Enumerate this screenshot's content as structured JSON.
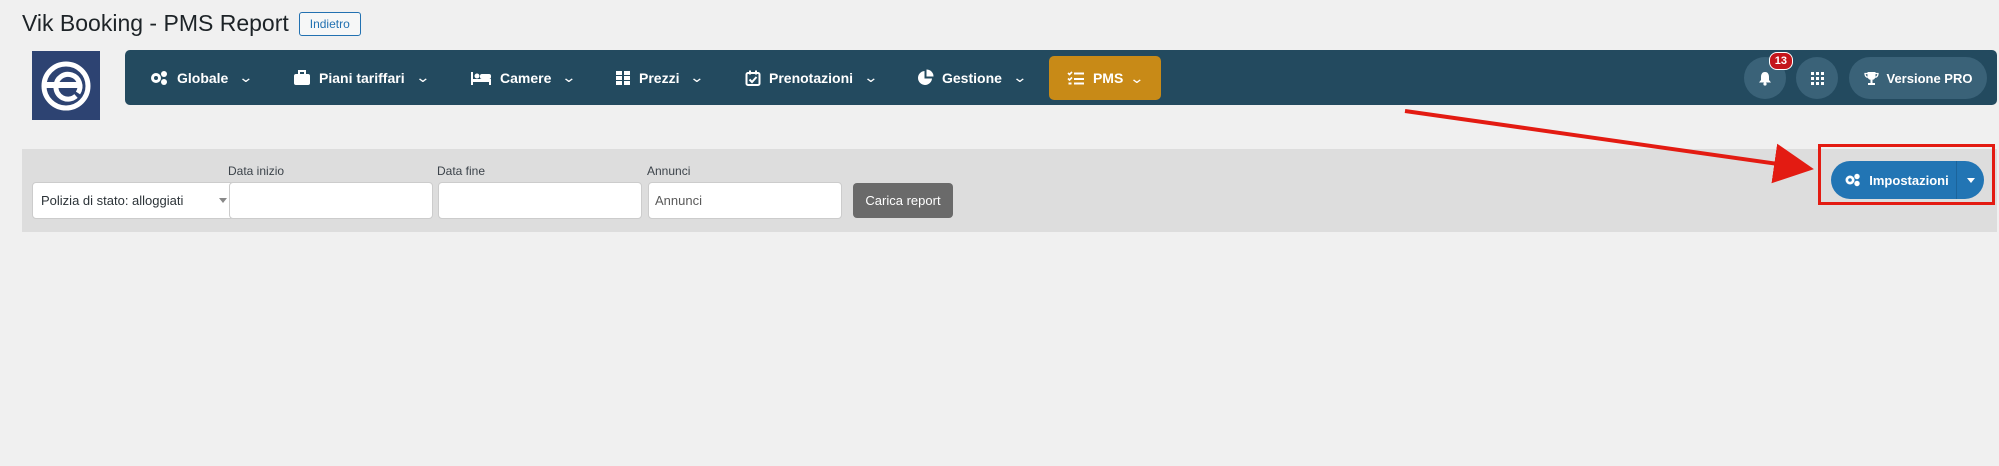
{
  "page": {
    "title": "Vik Booking - PMS Report",
    "back_label": "Indietro"
  },
  "logo": {
    "icon": "vikbooking-logo"
  },
  "nav": {
    "items": [
      {
        "label": "Globale",
        "icon": "gears-icon"
      },
      {
        "label": "Piani tariffari",
        "icon": "briefcase-icon"
      },
      {
        "label": "Camere",
        "icon": "bed-icon"
      },
      {
        "label": "Prezzi",
        "icon": "grid-icon"
      },
      {
        "label": "Prenotazioni",
        "icon": "calendar-check-icon"
      },
      {
        "label": "Gestione",
        "icon": "pie-chart-icon"
      }
    ],
    "active": {
      "label": "PMS",
      "icon": "list-check-icon"
    },
    "notifications_count": "13",
    "pro_label": "Versione PRO"
  },
  "filters": {
    "report_select_value": "Polizia di stato: alloggiati",
    "start_label": "Data inizio",
    "start_value": "",
    "end_label": "Data fine",
    "end_value": "",
    "announcements_label": "Annunci",
    "announcements_placeholder": "Annunci",
    "load_button": "Carica report"
  },
  "settings": {
    "label": "Impostazioni"
  },
  "colors": {
    "navbar": "#234a5f",
    "active_tab": "#c88a17",
    "settings_button": "#2275b4",
    "annotation": "#e31b12"
  }
}
